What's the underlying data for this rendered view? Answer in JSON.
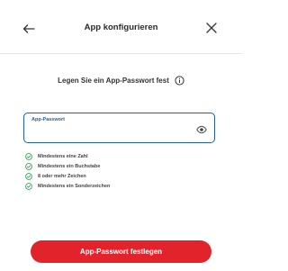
{
  "header": {
    "title": "App konfigurieren",
    "back_icon": "arrow-left-icon",
    "close_icon": "close-icon"
  },
  "main": {
    "subtitle": "Legen Sie ein App-Passwort fest",
    "info_icon": "info-icon",
    "password_field": {
      "label": "App-Passwort",
      "value": "",
      "visibility_icon": "eye-icon"
    },
    "requirements": [
      {
        "text": "Mindestens eine Zahl",
        "icon": "check-circle-icon",
        "status": "met"
      },
      {
        "text": "Mindestens ein Buchstabe",
        "icon": "check-circle-icon",
        "status": "met"
      },
      {
        "text": "8 oder mehr Zeichen",
        "icon": "check-circle-icon",
        "status": "met"
      },
      {
        "text": "Mindestens ein Sonderzeichen",
        "icon": "check-circle-icon",
        "status": "met"
      }
    ],
    "submit_label": "App-Passwort festlegen"
  },
  "colors": {
    "accent_red": "#e2232c",
    "focus_blue": "#1f5fa8",
    "success_green": "#3aa35a"
  }
}
